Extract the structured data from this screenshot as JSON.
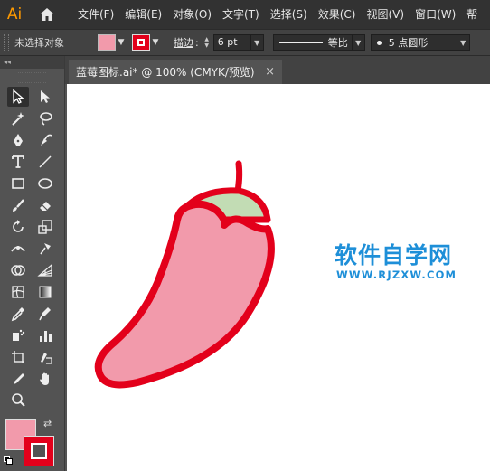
{
  "app": {
    "logo": "Ai",
    "logo_color": "#ff9a00"
  },
  "menu": [
    "文件(F)",
    "编辑(E)",
    "对象(O)",
    "文字(T)",
    "选择(S)",
    "效果(C)",
    "视图(V)",
    "窗口(W)",
    "帮"
  ],
  "control_bar": {
    "selection_status": "未选择对象",
    "stroke_label": "描边",
    "stroke_colon": ":",
    "stroke_weight": "6 pt",
    "profile_label": "等比",
    "brush_label": "5 点圆形"
  },
  "toolbar": {
    "collapse_label": "◂◂",
    "tools": [
      "selection-tool-icon",
      "direct-selection-tool-icon",
      "magic-wand-tool-icon",
      "lasso-tool-icon",
      "pen-tool-icon",
      "curvature-tool-icon",
      "type-tool-icon",
      "line-segment-tool-icon",
      "rectangle-tool-icon",
      "ellipse-tool-icon",
      "paintbrush-tool-icon",
      "eraser-tool-icon",
      "rotate-tool-icon",
      "scale-tool-icon",
      "width-tool-icon",
      "puppet-warp-tool-icon",
      "shape-builder-tool-icon",
      "perspective-grid-tool-icon",
      "mesh-tool-icon",
      "gradient-tool-icon",
      "eyedropper-tool-icon",
      "blend-tool-icon",
      "symbol-sprayer-tool-icon",
      "column-graph-tool-icon",
      "artboard-tool-icon",
      "slice-tool-icon",
      "hand-tool-icon",
      "zoom-tool-icon"
    ],
    "fill_color": "#f29aab",
    "stroke_color": "#e3001b"
  },
  "document_tab": {
    "title": "蓝莓图标.ai* @ 100% (CMYK/预览)",
    "close": "×"
  },
  "artwork": {
    "pepper_fill": "#f29aab",
    "pepper_stroke": "#e3001b",
    "cap_fill": "#c2dcb4"
  },
  "watermark": {
    "title": "软件自学网",
    "url": "WWW.RJZXW.COM",
    "color": "#1e8fd8"
  }
}
